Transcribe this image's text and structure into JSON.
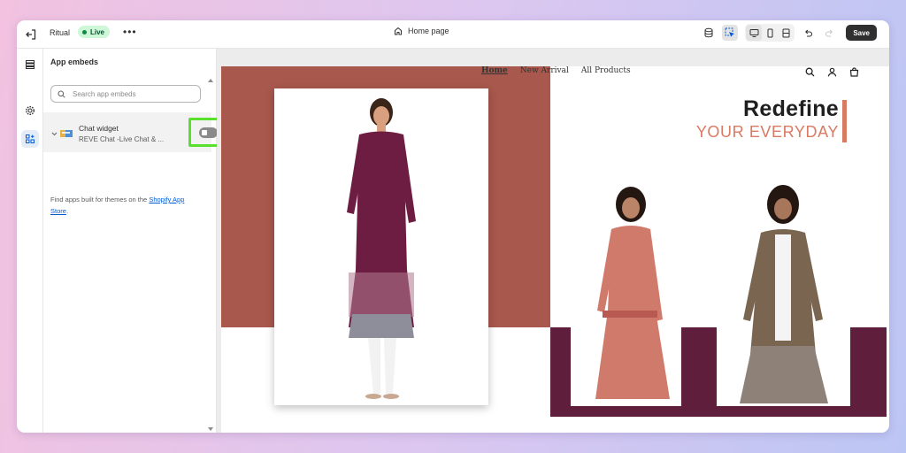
{
  "topbar": {
    "store_name": "Ritual",
    "status": "Live",
    "more": "•••",
    "page_name": "Home page",
    "save_label": "Save"
  },
  "sidebar": {
    "title": "App embeds",
    "search_placeholder": "Search app embeds",
    "embed": {
      "name": "Chat widget",
      "description": "REVE Chat -Live Chat & ...",
      "enabled": false
    },
    "footer_text": "Find apps built for themes on the ",
    "footer_link": "Shopify App Store",
    "footer_end": "."
  },
  "preview": {
    "nav": [
      "Home",
      "New Arrival",
      "All Products"
    ],
    "headline_line1": "Redefine",
    "headline_line2": "YOUR EVERYDAY",
    "colors": {
      "red_block": "#a8584c",
      "purple_block": "#5e1e3c",
      "accent": "#d97a63"
    }
  },
  "icons": {
    "topbar": [
      "exit-icon",
      "home-icon",
      "database-icon",
      "select-icon",
      "desktop-icon",
      "mobile-icon",
      "fullscreen-icon",
      "undo-icon",
      "redo-icon"
    ],
    "rail": [
      "sections-icon",
      "settings-icon",
      "apps-icon"
    ],
    "nav": [
      "search-icon",
      "account-icon",
      "cart-icon"
    ]
  }
}
